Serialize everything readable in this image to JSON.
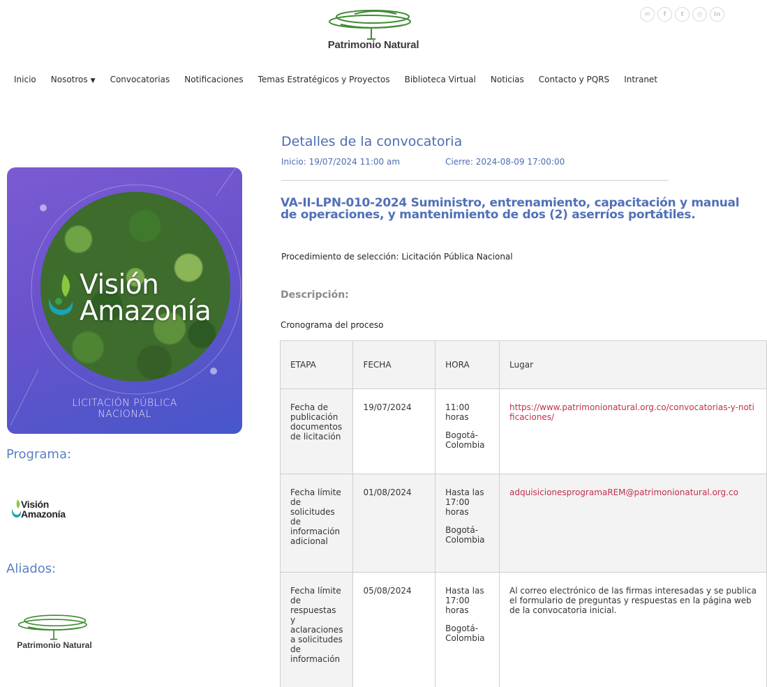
{
  "header": {
    "logo_text": "Patrimonio Natural",
    "social_icons": [
      "email-icon",
      "facebook-icon",
      "twitter-icon",
      "instagram-icon",
      "linkedin-icon"
    ]
  },
  "nav": {
    "items": [
      "Inicio",
      "Nosotros",
      "Convocatorias",
      "Notificaciones",
      "Temas Estratégicos y Proyectos",
      "Biblioteca Virtual",
      "Noticias",
      "Contacto y PQRS",
      "Intranet"
    ]
  },
  "sidebar": {
    "hero_title_1": "Visión",
    "hero_title_2": "Amazonía",
    "hero_sub_1": "LICITACIÓN PÚBLICA",
    "hero_sub_2": "NACIONAL",
    "programa_heading": "Programa:",
    "programa_logo_1": "Visión",
    "programa_logo_2": "Amazonía",
    "aliados_heading": "Aliados:",
    "aliados_logo_text": "Patrimonio Natural"
  },
  "main": {
    "title": "Detalles de la convocatoria",
    "inicio": "Inicio: 19/07/2024 11:00 am",
    "cierre": "Cierre: 2024-08-09 17:00:00",
    "process_title": "VA-II-LPN-010-2024 Suministro, entrenamiento, capacitación y manual de operaciones, y mantenimiento de dos (2) aserríos portátiles.",
    "procedimiento": "Procedimiento de selección: Licitación Pública Nacional",
    "descripcion_heading": "Descripción:",
    "cronograma_label": "Cronograma del proceso"
  },
  "schedule": {
    "headers": [
      "ETAPA",
      "FECHA",
      "HORA",
      "Lugar"
    ],
    "rows": [
      {
        "etapa": "Fecha de publicación documentos de licitación",
        "fecha": "19/07/2024",
        "hora": "11:00 horas",
        "ciudad": "Bogotá-Colombia",
        "lugar": "https://www.patrimonionatural.org.co/convocatorias-y-notificaciones/"
      },
      {
        "etapa": "Fecha límite de solicitudes de información adicional",
        "fecha": "01/08/2024",
        "hora": "Hasta las 17:00 horas",
        "ciudad": "Bogotá-Colombia",
        "lugar": "adquisicionesprogramaREM@patrimonionatural.org.co"
      },
      {
        "etapa": "Fecha límite de respuestas y aclaraciones a solicitudes de información",
        "fecha": "05/08/2024",
        "hora": "Hasta las 17:00 horas",
        "ciudad": "Bogotá-Colombia",
        "lugar": "Al correo electrónico de las firmas interesadas y se publica el formulario de preguntas y respuestas en la página web de la convocatoria inicial."
      }
    ]
  },
  "colors": {
    "heading_blue": "#4c6db2",
    "link_red": "#c0304a",
    "hero_purple": "#6a52cc"
  }
}
